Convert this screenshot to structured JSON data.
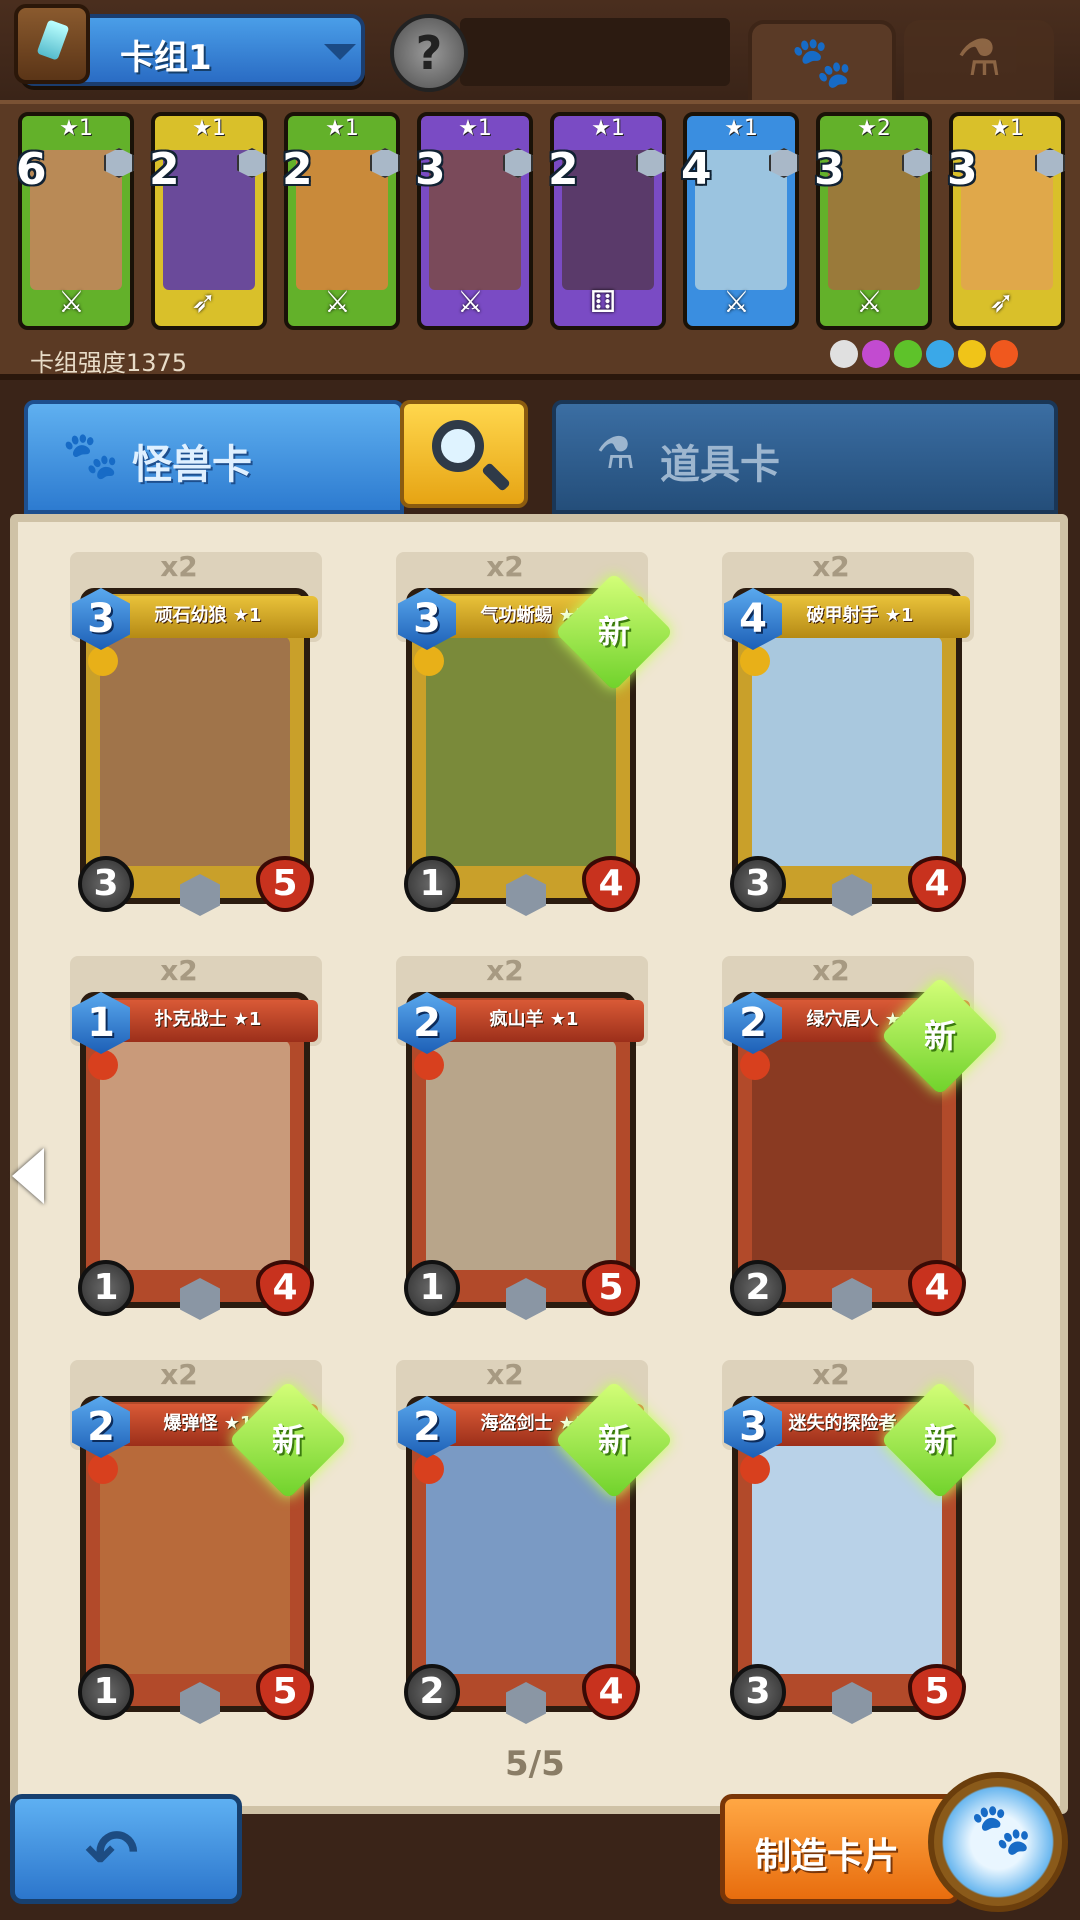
{
  "header": {
    "deck_name": "卡组1",
    "avatar_symbol": "?",
    "monster_tab_icon": "paw-icon",
    "item_tab_icon": "potion-icon"
  },
  "deck": {
    "power_label": "卡组强度1375",
    "cards": [
      {
        "stars": "★1",
        "cost": "6",
        "frame": "#63b12a",
        "art": "#b98a56",
        "icon": "sword"
      },
      {
        "stars": "★1",
        "cost": "2",
        "frame": "#d9c02a",
        "art": "#6a4a9a",
        "icon": "bow"
      },
      {
        "stars": "★1",
        "cost": "2",
        "frame": "#63b12a",
        "art": "#c98a3a",
        "icon": "sword"
      },
      {
        "stars": "★1",
        "cost": "3",
        "frame": "#7a4bc4",
        "art": "#7a4a5a",
        "icon": "sword"
      },
      {
        "stars": "★1",
        "cost": "2",
        "frame": "#7a4bc4",
        "art": "#5a3a6a",
        "icon": "dice"
      },
      {
        "stars": "★1",
        "cost": "4",
        "frame": "#3a8ee0",
        "art": "#9bc4e0",
        "icon": "sword"
      },
      {
        "stars": "★2",
        "cost": "3",
        "frame": "#63b12a",
        "art": "#9a7a3a",
        "icon": "sword"
      },
      {
        "stars": "★1",
        "cost": "3",
        "frame": "#d9c02a",
        "art": "#e0a84a",
        "icon": "bow"
      }
    ],
    "elements": [
      "#e0e0e0",
      "#c24bd0",
      "#5ec22a",
      "#3aa8e8",
      "#f0c418",
      "#f0581e"
    ]
  },
  "tabs": {
    "monster_label": "怪兽卡",
    "item_label": "道具卡"
  },
  "cards": [
    {
      "count": "x2",
      "name": "顽石幼狼 ★1",
      "cost": "3",
      "atk": "3",
      "hp": "5",
      "frame": "gold",
      "is_new": false,
      "new_label": "",
      "art": "#a0744a"
    },
    {
      "count": "x2",
      "name": "气功蜥蜴 ★1",
      "cost": "3",
      "atk": "1",
      "hp": "4",
      "frame": "gold",
      "is_new": true,
      "new_label": "新",
      "art": "#7a8a3a"
    },
    {
      "count": "x2",
      "name": "破甲射手 ★1",
      "cost": "4",
      "atk": "3",
      "hp": "4",
      "frame": "gold",
      "is_new": false,
      "new_label": "",
      "art": "#a9c8de"
    },
    {
      "count": "x2",
      "name": "扑克战士 ★1",
      "cost": "1",
      "atk": "1",
      "hp": "4",
      "frame": "red",
      "is_new": false,
      "new_label": "",
      "art": "#c99a7a"
    },
    {
      "count": "x2",
      "name": "疯山羊 ★1",
      "cost": "2",
      "atk": "1",
      "hp": "5",
      "frame": "red",
      "is_new": false,
      "new_label": "",
      "art": "#b8a58a"
    },
    {
      "count": "x2",
      "name": "绿穴居人 ★1",
      "cost": "2",
      "atk": "2",
      "hp": "4",
      "frame": "red",
      "is_new": true,
      "new_label": "新",
      "art": "#8a3a22"
    },
    {
      "count": "x2",
      "name": "爆弹怪 ★1",
      "cost": "2",
      "atk": "1",
      "hp": "5",
      "frame": "red",
      "is_new": true,
      "new_label": "新",
      "art": "#b86a3a"
    },
    {
      "count": "x2",
      "name": "海盗剑士 ★1",
      "cost": "2",
      "atk": "2",
      "hp": "4",
      "frame": "red",
      "is_new": true,
      "new_label": "新",
      "art": "#7a9ac4"
    },
    {
      "count": "x2",
      "name": "迷失的探险者 ★1",
      "cost": "3",
      "atk": "3",
      "hp": "5",
      "frame": "red",
      "is_new": true,
      "new_label": "新",
      "art": "#b9d2e8"
    }
  ],
  "pager": "5/5",
  "footer": {
    "craft_label": "制造卡片",
    "back_icon": "back-arrow-icon"
  }
}
